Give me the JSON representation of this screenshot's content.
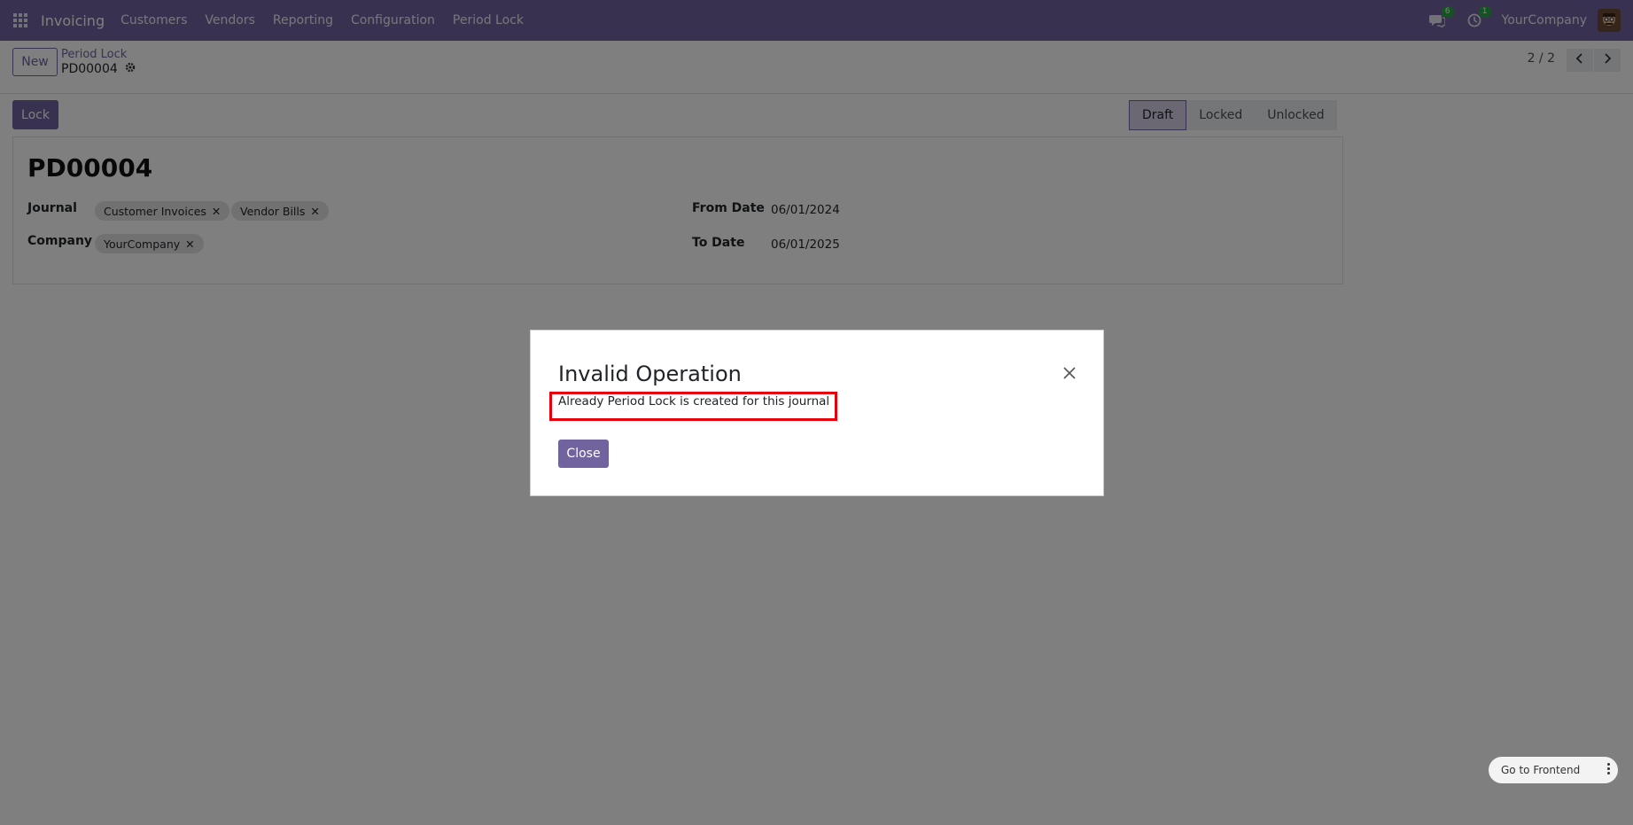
{
  "navbar": {
    "app_name": "Invoicing",
    "menu": [
      "Customers",
      "Vendors",
      "Reporting",
      "Configuration",
      "Period Lock"
    ],
    "messages_badge": "6",
    "activities_badge": "1",
    "company": "YourCompany"
  },
  "control_panel": {
    "new_label": "New",
    "breadcrumb": "Period Lock",
    "record_name": "PD00004",
    "pager": "2 / 2"
  },
  "statusbar": {
    "lock_label": "Lock",
    "stages": [
      "Draft",
      "Locked",
      "Unlocked"
    ],
    "active_stage": "Draft"
  },
  "form": {
    "title": "PD00004",
    "journal_label": "Journal",
    "journal_tags": [
      "Customer Invoices",
      "Vendor Bills"
    ],
    "company_label": "Company",
    "company_tags": [
      "YourCompany"
    ],
    "from_date_label": "From Date",
    "from_date": "06/01/2024",
    "to_date_label": "To Date",
    "to_date": "06/01/2025"
  },
  "dialog": {
    "title": "Invalid Operation",
    "message": "Already Period Lock is created for this journal",
    "close_label": "Close"
  },
  "frontend_button": {
    "label": "Go to Frontend"
  },
  "colors": {
    "brand": "#71639e",
    "highlight": "#e8000b",
    "badge": "#28a745"
  }
}
